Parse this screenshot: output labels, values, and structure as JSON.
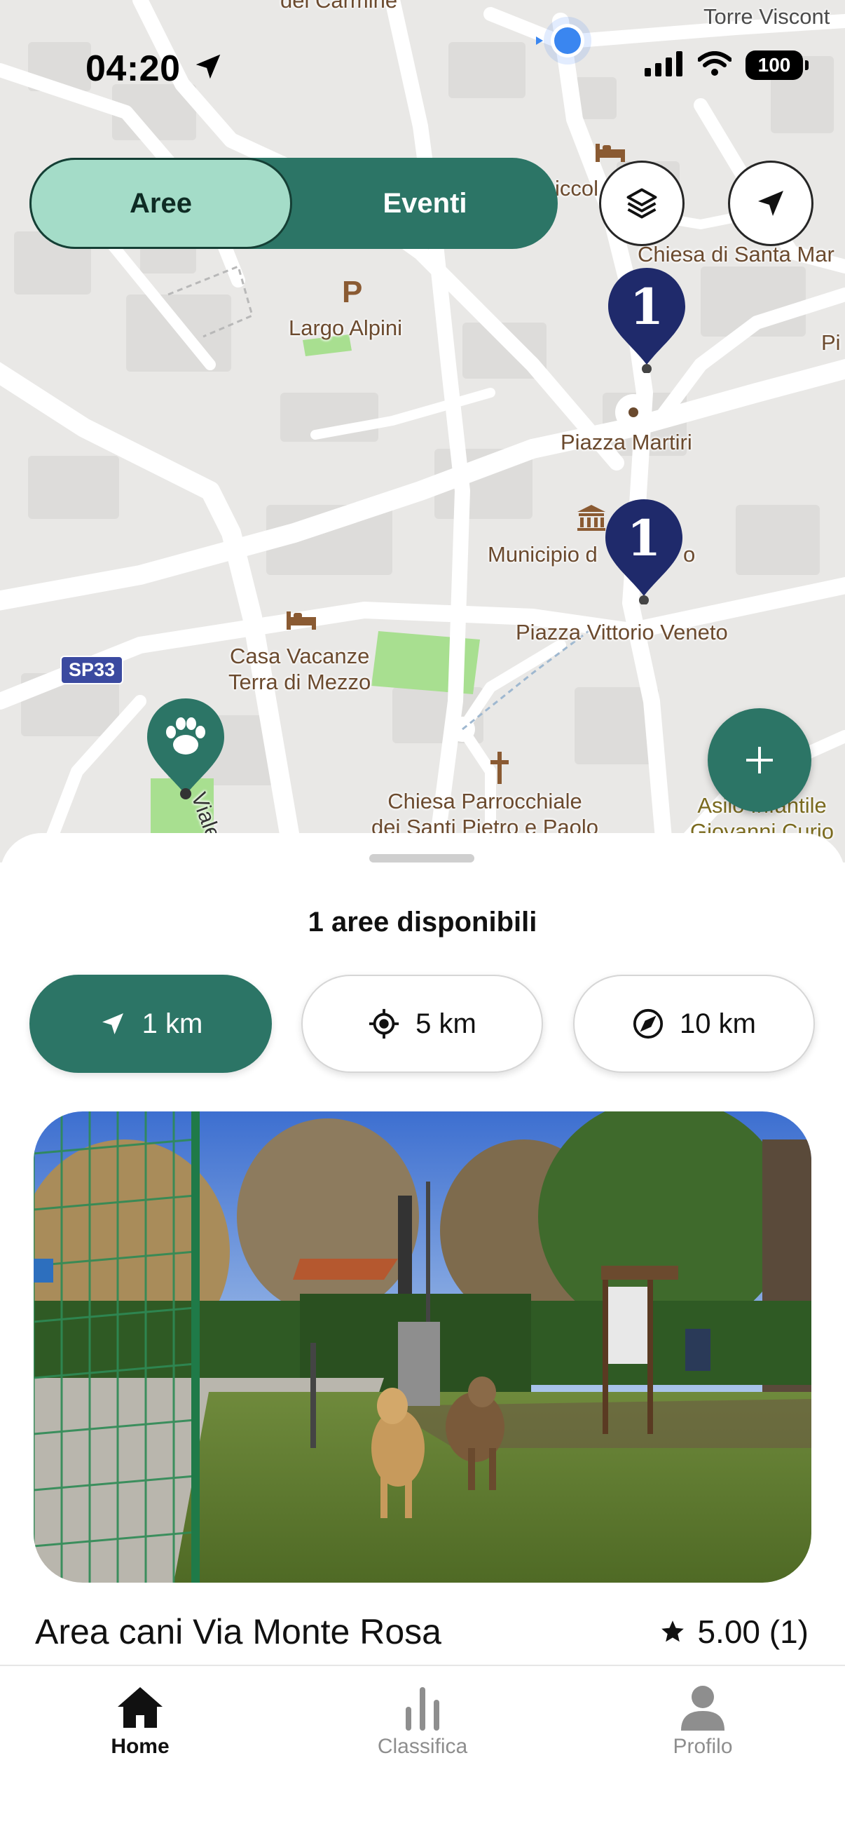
{
  "status_bar": {
    "time": "04:20",
    "battery": "100"
  },
  "map": {
    "labels": {
      "del_carmine": "del Carmine",
      "torre": "Torre Viscont",
      "piccolo": "iccol",
      "chiesa_santa": "Chiesa di Santa Mar",
      "largo_alpini": "Largo Alpini",
      "pi": "Pi",
      "piazza_martiri": "Piazza Martiri",
      "municipio": "Municipio d",
      "municipio_tail": "o",
      "casa_vacanze_1": "Casa Vacanze",
      "casa_vacanze_2": "Terra di Mezzo",
      "piazza_vittorio": "Piazza Vittorio Veneto",
      "sp33": "SP33",
      "viale": "Viale",
      "chiesa_parr_1": "Chiesa Parrocchiale",
      "chiesa_parr_2": "dei Santi Pietro e Paolo",
      "asilo_1": "Asilo Infantile",
      "asilo_2": "Giovanni Curio",
      "parking": "P"
    },
    "cluster_badges": [
      "1",
      "1"
    ]
  },
  "toggle": {
    "areas": "Aree",
    "events": "Eventi",
    "selected": "Aree"
  },
  "sheet": {
    "title": "1 aree disponibili",
    "filters": [
      {
        "label": "1 km",
        "icon": "location-arrow-icon",
        "active": true
      },
      {
        "label": "5 km",
        "icon": "crosshair-icon",
        "active": false
      },
      {
        "label": "10 km",
        "icon": "compass-icon",
        "active": false
      }
    ],
    "card": {
      "name": "Area cani Via Monte Rosa",
      "rating": "5.00 (1)"
    }
  },
  "tabbar": {
    "home": "Home",
    "ranking": "Classifica",
    "profile": "Profilo"
  },
  "colors": {
    "accent": "#2c7566",
    "accent_light": "#a4dcc8",
    "pin_navy": "#1f2a6b"
  }
}
